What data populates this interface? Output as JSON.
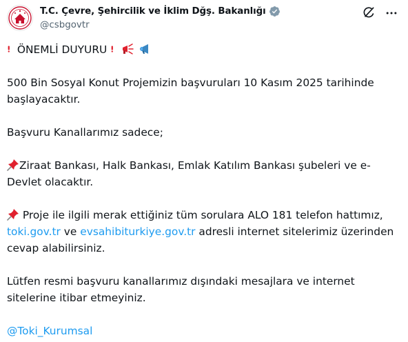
{
  "account": {
    "display_name": "T.C. Çevre, Şehircilik ve İklim Dğş. Bakanlığı",
    "handle": "@csbgovtr",
    "verified_icon": "government-verified-badge",
    "avatar_icon": "ministry-seal"
  },
  "actions": {
    "grok_icon": "grok-icon",
    "more_icon": "more-icon"
  },
  "post": {
    "heading": "ÖNEMLİ DUYURU",
    "p1_line1": "500 Bin Sosyal Konut Projemizin başvuruları 10 Kasım 2025 tarihinde",
    "p1_line2": "başlayacaktır.",
    "p2": "Başvuru Kanallarımız sadece;",
    "p3_line1": "Ziraat Bankası, Halk Bankası, Emlak Katılım Bankası şubeleri ve e-",
    "p3_line2": "Devlet olacaktır.",
    "p4_line1": " Proje ile ilgili merak ettiğiniz tüm sorulara ALO 181 telefon hattımız,",
    "link_toki": "toki.gov.tr",
    "p4_and": " ve ",
    "link_evsahibi": "evsahibiturkiye.gov.tr",
    "p4_line2_rest": " adresli internet sitelerimiz üzerinden",
    "p4_line3": "cevap alabilirsiniz.",
    "p5_line1": "Lütfen resmi başvuru kanallarımız dışındaki mesajlara ve internet",
    "p5_line2": "sitelerine itibar etmeyiniz.",
    "mention": "@Toki_Kurumsal"
  },
  "colors": {
    "text": "#0f1419",
    "secondary": "#536471",
    "link": "#1d9bf0",
    "brand_red": "#c8102e",
    "verified_gray": "#829aab"
  }
}
